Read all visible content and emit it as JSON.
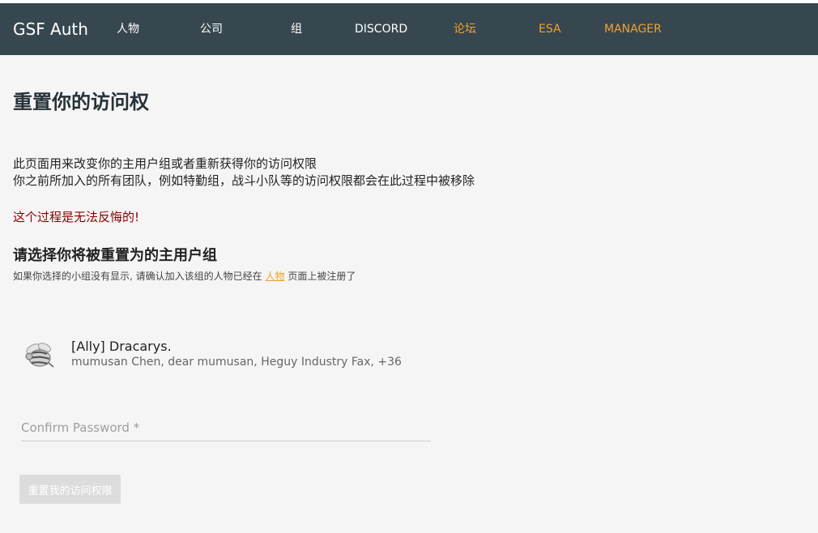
{
  "nav": {
    "brand": "GSF Auth",
    "items": [
      {
        "label": "人物"
      },
      {
        "label": "公司"
      },
      {
        "label": "组"
      },
      {
        "label": "DISCORD"
      },
      {
        "label": "论坛"
      },
      {
        "label": "ESA"
      },
      {
        "label": "MANAGER"
      }
    ],
    "accent_color": "#f0a030",
    "bar_color": "#37474f"
  },
  "main": {
    "title": "重置你的访问权",
    "description_line1": "此页面用来改变你的主用户组或者重新获得你的访问权限",
    "description_line2": "你之前所加入的所有团队，例如特勤组，战斗小队等的访问权限都会在此过程中被移除",
    "warning": "这个过程是无法反悔的!",
    "select_heading": "请选择你将被重置为的主用户组",
    "hint_before": "如果你选择的小组没有显示, 请确认加入该组的人物已经在",
    "hint_link": "人物",
    "hint_after": "页面上被注册了",
    "group": {
      "name": "[Ally] Dracarys.",
      "members": "mumusan Chen, dear mumusan, Heguy Industry Fax, +36",
      "avatar_icon": "bee-logo-icon"
    },
    "password_placeholder": "Confirm Password *",
    "password_value": "",
    "submit_label": "重置我的访问权限"
  }
}
